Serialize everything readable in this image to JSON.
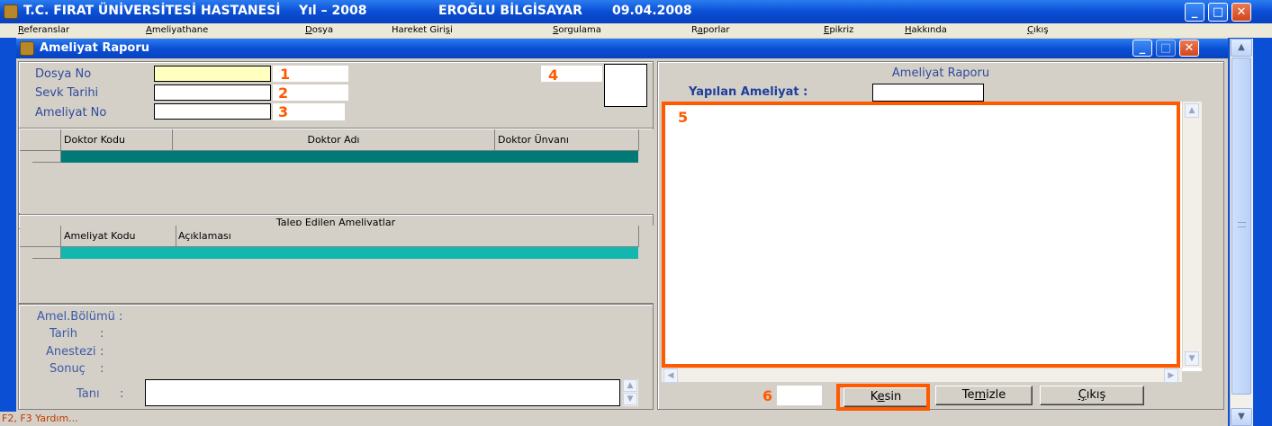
{
  "window": {
    "title_hospital": "T.C. FIRAT ÜNİVERSİTESİ HASTANESİ",
    "title_year": "Yıl – 2008",
    "title_vendor": "EROĞLU BİLGİSAYAR",
    "title_date": "09.04.2008"
  },
  "menu": [
    {
      "pre": "",
      "u": "R",
      "post": "eferanslar"
    },
    {
      "pre": "",
      "u": "A",
      "post": "meliyathane"
    },
    {
      "pre": "",
      "u": "D",
      "post": "osya"
    },
    {
      "pre": "Hareket Giri",
      "u": "ş",
      "post": "i"
    },
    {
      "pre": "",
      "u": "S",
      "post": "orgulama"
    },
    {
      "pre": "R",
      "u": "a",
      "post": "porlar"
    },
    {
      "pre": "",
      "u": "E",
      "post": "pikriz"
    },
    {
      "pre": "",
      "u": "H",
      "post": "akkında"
    },
    {
      "pre": "",
      "u": "Ç",
      "post": "ıkış"
    }
  ],
  "child": {
    "title": "Ameliyat Raporu"
  },
  "form": {
    "dosya_no_label": "Dosya No",
    "sevk_tarihi_label": "Sevk Tarihi",
    "ameliyat_no_label": "Ameliyat No",
    "dosya_no_value": "",
    "sevk_tarihi_value": "",
    "ameliyat_no_value": ""
  },
  "annotations": {
    "n1": "1",
    "n2": "2",
    "n3": "3",
    "n4": "4",
    "n5": "5",
    "n6": "6"
  },
  "doctor_grid": {
    "columns": [
      "Doktor Kodu",
      "Doktor Adı",
      "Doktor Ünvanı"
    ]
  },
  "requested": {
    "section_title": "Talep Edilen  Ameliyatlar",
    "columns": [
      "Ameliyat Kodu",
      "Açıklaması"
    ]
  },
  "info": {
    "bolum_label": "Amel.Bölümü :",
    "tarih_label": "Tarih",
    "anestezi_label": "Anestezi",
    "sonuc_label": "Sonuç",
    "colon": ":",
    "tani_label": "Tanı",
    "tani_value": ""
  },
  "report": {
    "title": "Ameliyat Raporu",
    "yapilan_label": "Yapılan Ameliyat  :",
    "yapilan_value": "",
    "body_text": ""
  },
  "buttons": {
    "kesin": {
      "pre": "K",
      "u": "e",
      "post": "sin"
    },
    "temizle": {
      "pre": "Te",
      "u": "m",
      "post": "izle"
    },
    "cikis": {
      "pre": "",
      "u": "Ç",
      "post": "ıkış"
    }
  },
  "status": {
    "text": "F2, F3 Yardım..."
  },
  "colors": {
    "accent_orange": "#ff5a00",
    "label_blue": "#2f4a9c",
    "grid_teal": "#007a76",
    "grid_cyan": "#12b8b0"
  }
}
